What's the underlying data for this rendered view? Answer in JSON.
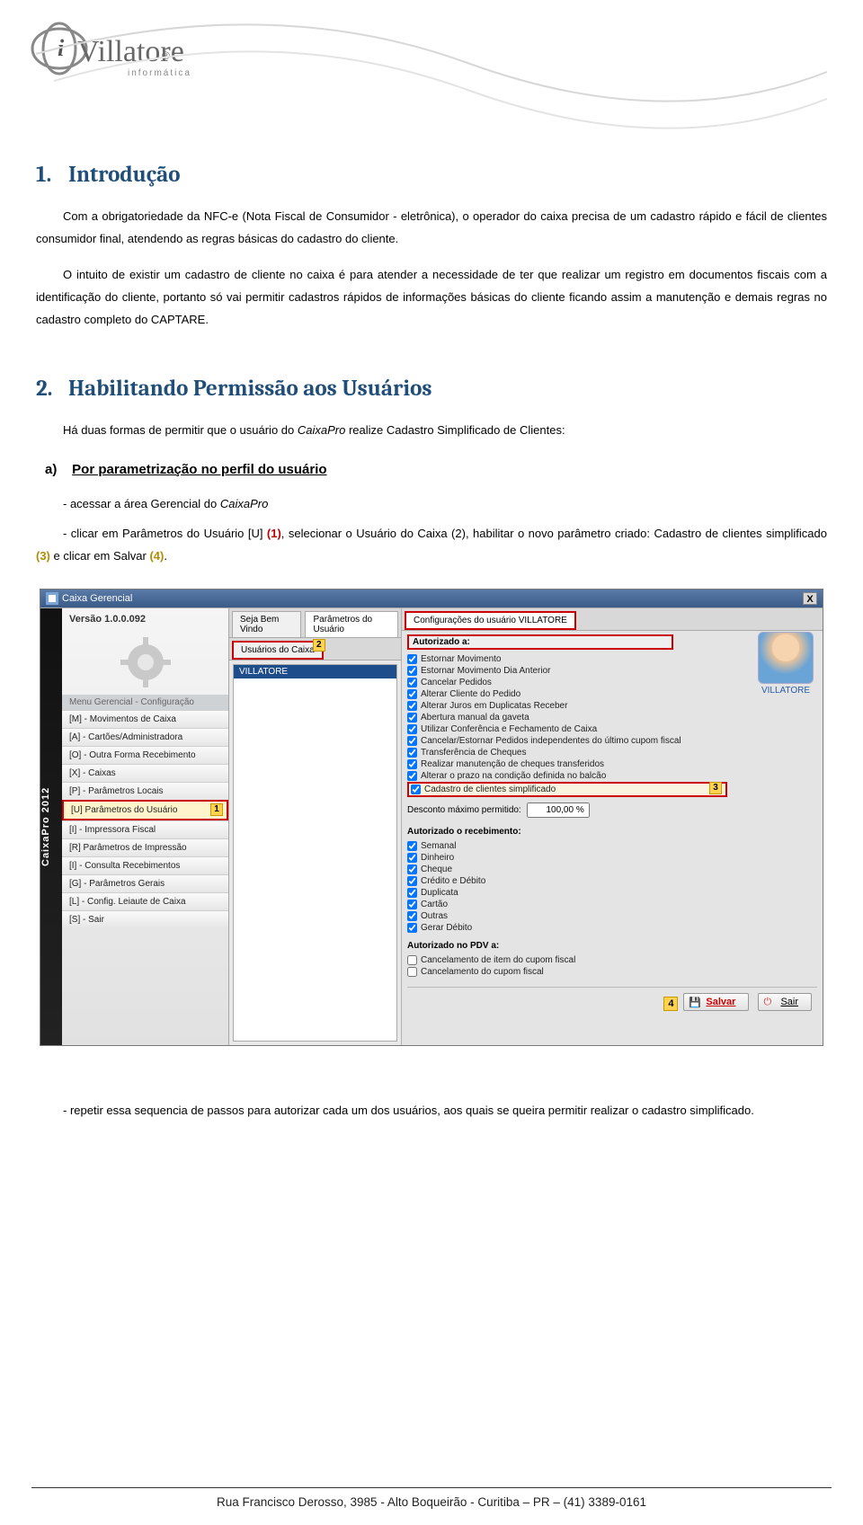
{
  "logo_text": "Villatore",
  "logo_sub": "informática",
  "section1": {
    "num": "1.",
    "title": "Introdução",
    "para1": "Com a obrigatoriedade da NFC-e (Nota Fiscal de Consumidor - eletrônica), o operador do caixa precisa de um cadastro rápido e fácil de clientes consumidor final, atendendo as regras básicas do cadastro do cliente.",
    "para2": "O intuito de existir um cadastro de cliente no caixa é para atender a necessidade de ter que realizar um registro em documentos fiscais com a identificação do cliente, portanto só vai permitir cadastros rápidos de informações básicas do cliente ficando assim a manutenção e demais regras no cadastro completo do CAPTARE."
  },
  "section2": {
    "num": "2.",
    "title": "Habilitando Permissão aos Usuários",
    "intro_pre": "Há duas formas de permitir que o usuário do ",
    "intro_em": "CaixaPro",
    "intro_post": " realize Cadastro Simplificado de Clientes:",
    "step_a_letter": "a)",
    "step_a_text": "Por parametrização no perfil do usuário",
    "bullet1_pre": "- acessar a área Gerencial do ",
    "bullet1_em": "CaixaPro",
    "bullet2_a": "- clicar em Parâmetros do Usuário [U] ",
    "bullet2_h1": "(1)",
    "bullet2_b": ", selecionar o Usuário do Caixa (2), habilitar o novo parâmetro criado: Cadastro de clientes simplificado ",
    "bullet2_h3": "(3)",
    "bullet2_c": " e clicar em Salvar ",
    "bullet2_h4": "(4)",
    "bullet2_d": ".",
    "after_shot": "- repetir essa sequencia de passos para autorizar cada um dos usuários, aos quais se queira permitir realizar o cadastro simplificado."
  },
  "shot": {
    "title": "Caixa Gerencial",
    "close": "X",
    "sideband": "CaixaPro 2012",
    "version_label": "Versão 1.0.0.092",
    "menu_header": "Menu Gerencial - Configuração",
    "menu": [
      "[M] - Movimentos de Caixa",
      "[A] - Cartões/Administradora",
      "[O] - Outra Forma Recebimento",
      "[X] - Caixas",
      "[P] - Parâmetros Locais",
      "[U] Parâmetros do Usuário",
      "[I] - Impressora Fiscal",
      "[R] Parâmetros de Impressão",
      "[I] - Consulta Recebimentos",
      "[G] - Parâmetros Gerais",
      "[L] - Config. Leiaute de Caixa",
      "[S] - Sair"
    ],
    "tag1": "1",
    "tabs_top_left": "Seja Bem  Vindo",
    "tabs_top_right": "Parâmetros do Usuário",
    "center_tab": "Usuários do Caixa",
    "tag2": "2",
    "user": "VILLATORE",
    "right_tab": "Configurações do usuário VILLATORE",
    "group_auth": "Autorizado a:",
    "perms": [
      "Estornar Movimento",
      "Estornar Movimento Dia Anterior",
      "Cancelar Pedidos",
      "Alterar Cliente do Pedido",
      "Alterar Juros em Duplicatas Receber",
      "Abertura manual da gaveta",
      "Utilizar Conferência e Fechamento de Caixa",
      "Cancelar/Estornar Pedidos independentes do último cupom fiscal",
      "Transferência de Cheques",
      "Realizar manutenção de cheques transferidos",
      "Alterar o prazo na condição definida no balcão",
      "Cadastro de clientes simplificado"
    ],
    "tag3": "3",
    "discount_label": "Desconto máximo permitido:",
    "discount_value": "100,00 %",
    "group_recv": "Autorizado o recebimento:",
    "recv": [
      "Semanal",
      "Dinheiro",
      "Cheque",
      "Crédito e Débito",
      "Duplicata",
      "Cartão",
      "Outras",
      "Gerar Débito"
    ],
    "group_pdv": "Autorizado no PDV a:",
    "pdv": [
      "Cancelamento de item do cupom fiscal",
      "Cancelamento do cupom fiscal"
    ],
    "tag4": "4",
    "btn_save": "Salvar",
    "btn_exit": "Sair",
    "avatar_name": "VILLATORE"
  },
  "footer": "Rua Francisco Derosso, 3985  - Alto Boqueirão - Curitiba – PR  – (41) 3389-0161"
}
